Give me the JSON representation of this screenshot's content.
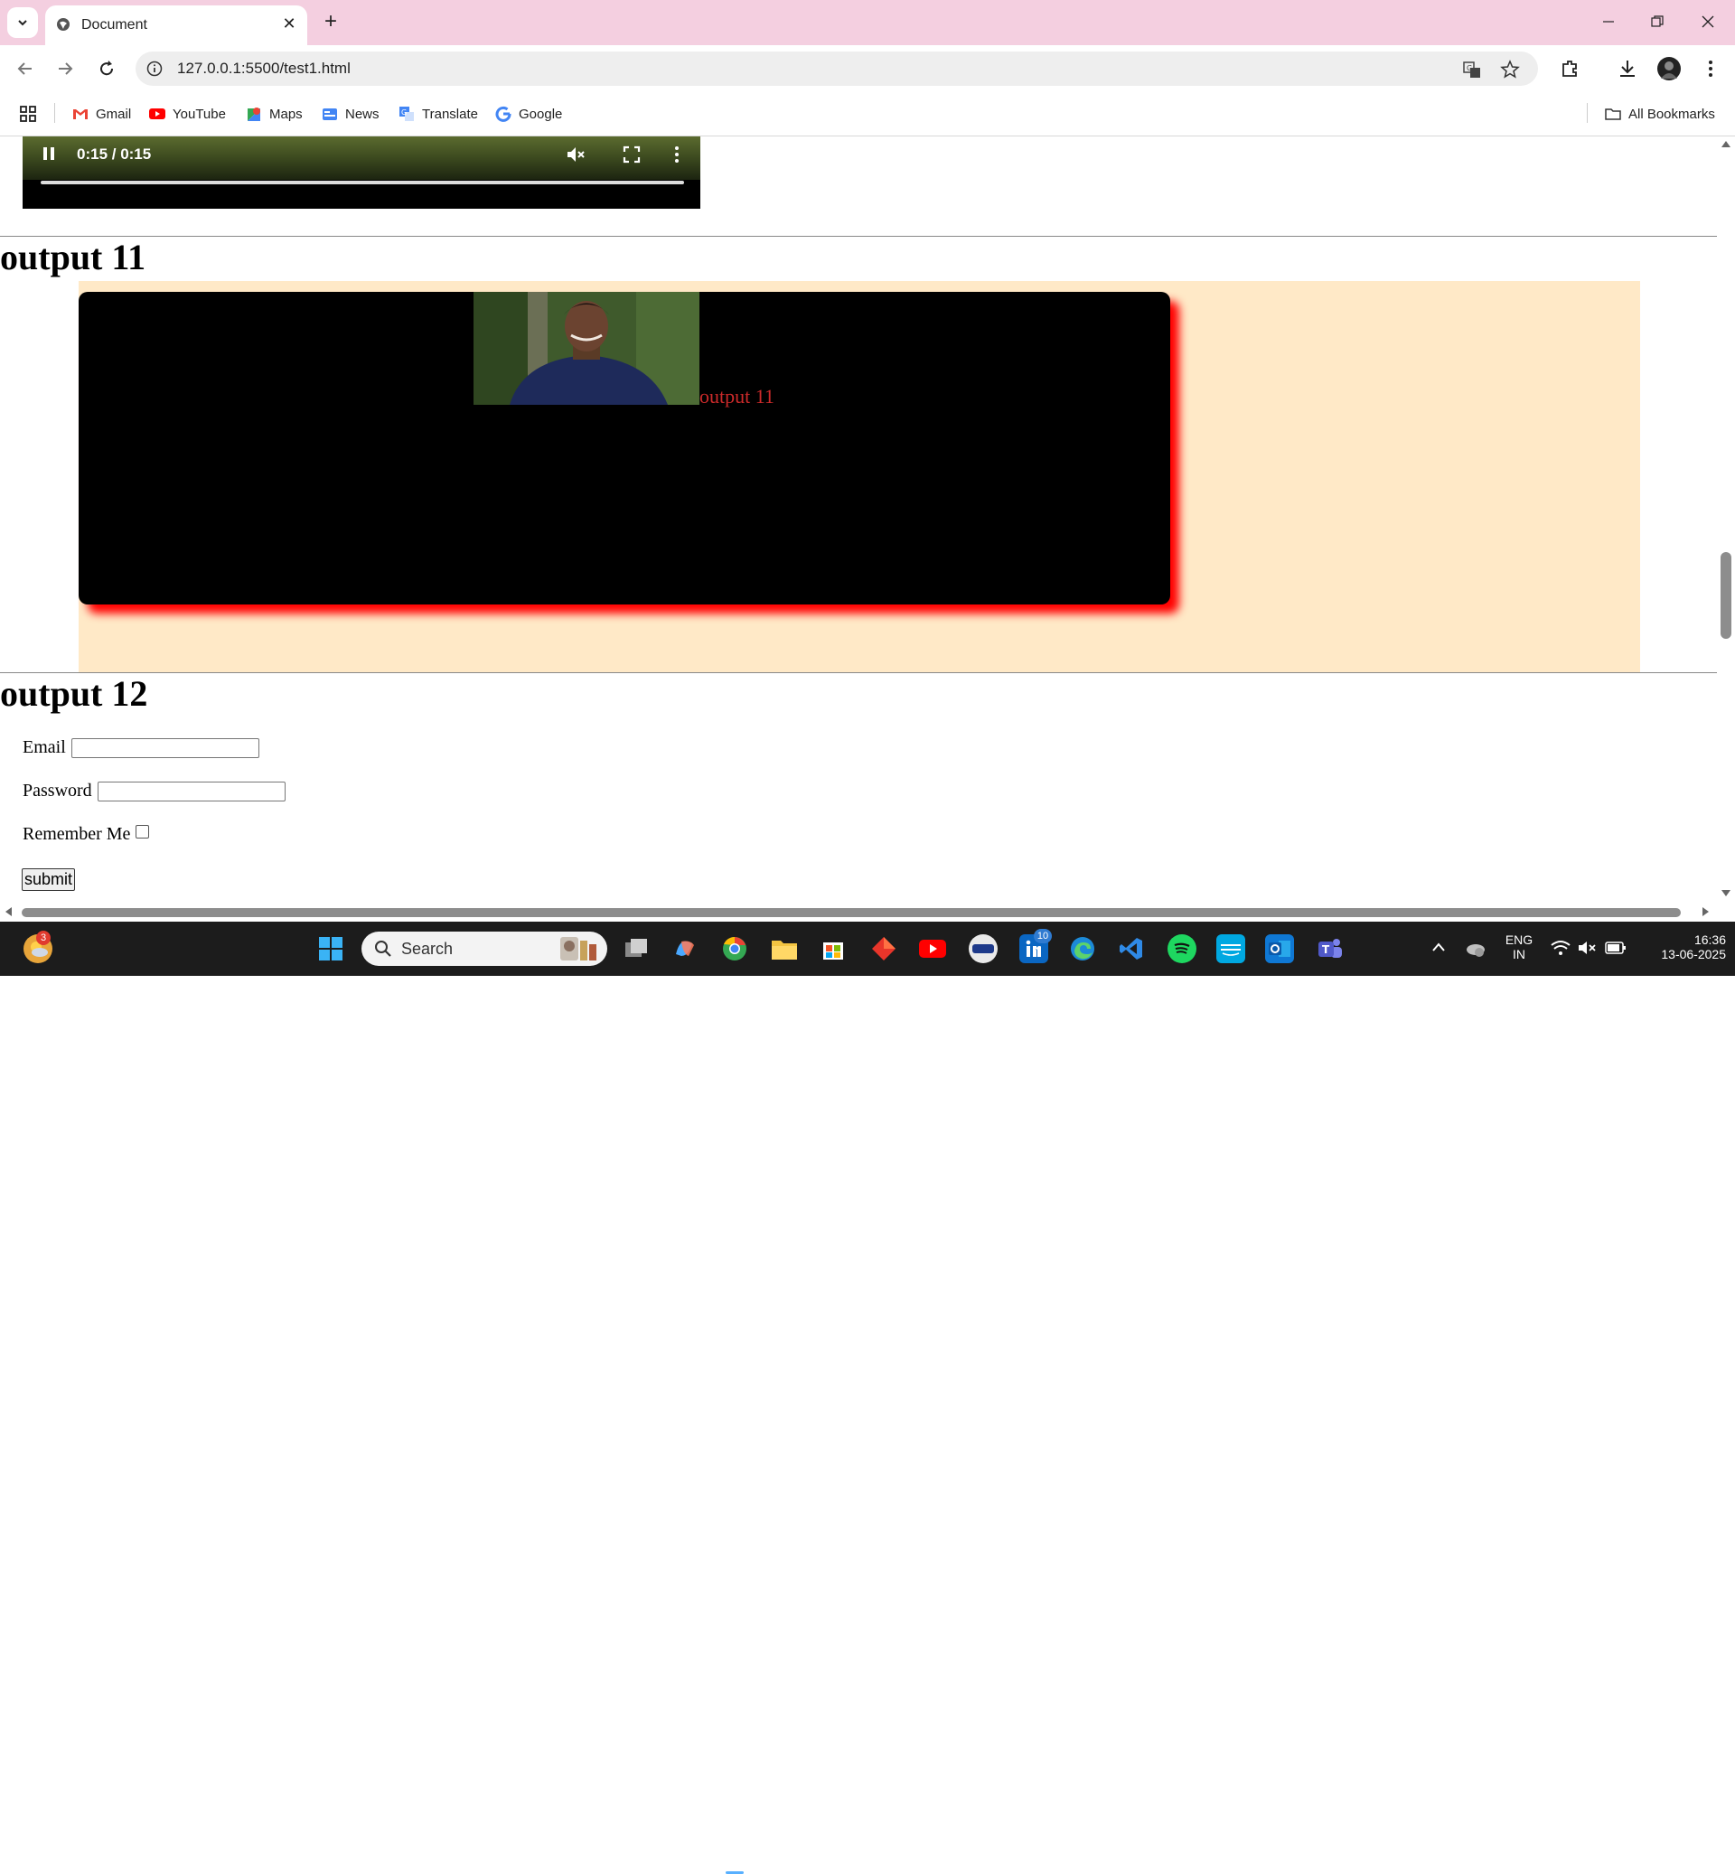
{
  "browser": {
    "tab_title": "Document",
    "url": "127.0.0.1:5500/test1.html",
    "bookmarks": [
      "Gmail",
      "YouTube",
      "Maps",
      "News",
      "Translate",
      "Google"
    ],
    "all_bookmarks": "All Bookmarks"
  },
  "page": {
    "video_time": "0:15 / 0:15",
    "section11_heading": "output 11",
    "section11_caption": "output 11",
    "section12_heading": "output 12",
    "form": {
      "email_label": "Email",
      "password_label": "Password",
      "remember_label": "Remember Me",
      "submit_label": "submit"
    }
  },
  "taskbar": {
    "search_label": "Search",
    "weather_badge": "3",
    "linkedin_badge": "10",
    "lang": "ENG",
    "region": "IN",
    "time": "16:36",
    "date": "13-06-2025"
  },
  "colors": {
    "tabbar": "#f4cfe0",
    "peach_bg": "#ffe9c7",
    "shadow": "#ff0000",
    "caption": "#cc2a2a"
  }
}
